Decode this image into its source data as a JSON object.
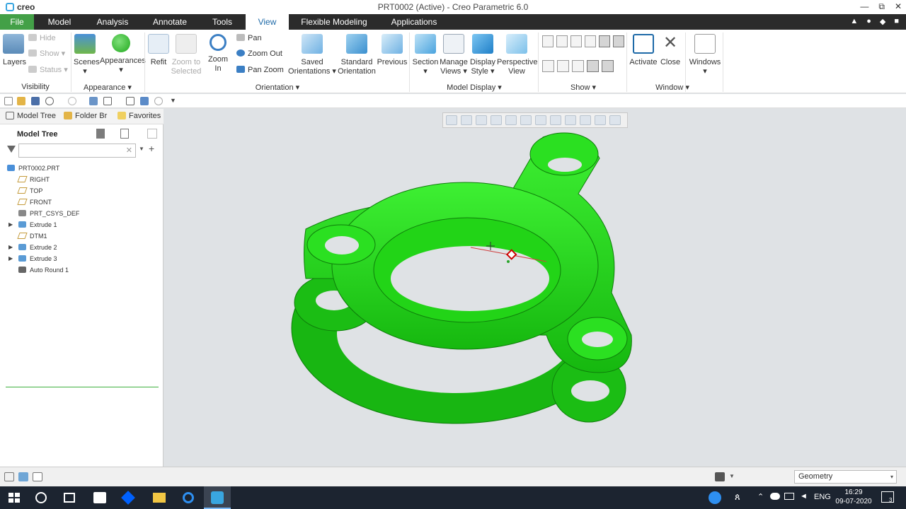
{
  "window": {
    "app_logo": "creo",
    "title": "PRT0002 (Active) - Creo Parametric 6.0",
    "minimize": "—",
    "maximize": "⧉",
    "close": "✕"
  },
  "menu": {
    "tabs": [
      "File",
      "Model",
      "Analysis",
      "Annotate",
      "Tools",
      "View",
      "Flexible Modeling",
      "Applications"
    ],
    "active": "View"
  },
  "ribbon": {
    "visibility": {
      "layers": "Layers",
      "hide": "Hide",
      "show": "Show",
      "status": "Status",
      "group": "Visibility"
    },
    "appearance": {
      "scenes": "Scenes",
      "appearances": "Appearances",
      "group": "Appearance ▾"
    },
    "orientation": {
      "refit": "Refit",
      "zoom_to_selected_1": "Zoom to",
      "zoom_to_selected_2": "Selected",
      "zoom_in": "Zoom In",
      "pan": "Pan",
      "zoom_out": "Zoom Out",
      "pan_zoom": "Pan Zoom",
      "saved_1": "Saved",
      "saved_2": "Orientations ▾",
      "standard_1": "Standard",
      "standard_2": "Orientation",
      "previous": "Previous",
      "group": "Orientation ▾"
    },
    "model_display": {
      "section": "Section",
      "section_arrow": "▾",
      "manage_1": "Manage",
      "manage_2": "Views ▾",
      "display_1": "Display",
      "display_2": "Style ▾",
      "perspective_1": "Perspective",
      "perspective_2": "View",
      "group": "Model Display ▾"
    },
    "show": {
      "group": "Show ▾"
    },
    "window": {
      "activate": "Activate",
      "close": "Close",
      "group": "Window ▾"
    },
    "windows": {
      "label": "Windows",
      "arrow": "▾"
    }
  },
  "panel": {
    "tabs": [
      "Model Tree",
      "Folder Br",
      "Favorites"
    ],
    "header": "Model Tree",
    "search_placeholder": "",
    "search_clear": "✕",
    "tree": [
      {
        "label": "PRT0002.PRT",
        "icon": "part-icon",
        "color": "#4a90d9"
      },
      {
        "label": "RIGHT",
        "icon": "datum-plane-icon",
        "color": "#c49a3a"
      },
      {
        "label": "TOP",
        "icon": "datum-plane-icon",
        "color": "#c49a3a"
      },
      {
        "label": "FRONT",
        "icon": "datum-plane-icon",
        "color": "#c49a3a"
      },
      {
        "label": "PRT_CSYS_DEF",
        "icon": "csys-icon",
        "color": "#888888"
      },
      {
        "label": "Extrude 1",
        "icon": "extrude-icon",
        "color": "#5a9bd5",
        "expand": "▶"
      },
      {
        "label": "DTM1",
        "icon": "datum-plane-icon",
        "color": "#c49a3a"
      },
      {
        "label": "Extrude 2",
        "icon": "extrude-icon",
        "color": "#5a9bd5",
        "expand": "▶"
      },
      {
        "label": "Extrude 3",
        "icon": "extrude-icon",
        "color": "#5a9bd5",
        "expand": "▶"
      },
      {
        "label": "Auto Round 1",
        "icon": "round-icon",
        "color": "#666666"
      }
    ]
  },
  "status": {
    "filter": "Geometry",
    "filter_arrow": "▾"
  },
  "taskbar": {
    "lang": "ENG",
    "time": "16:29",
    "date": "09-07-2020",
    "notifications": "3"
  },
  "colors": {
    "model_green": "#22d417",
    "file_tab": "#43a047",
    "accent": "#1e6aa8"
  }
}
